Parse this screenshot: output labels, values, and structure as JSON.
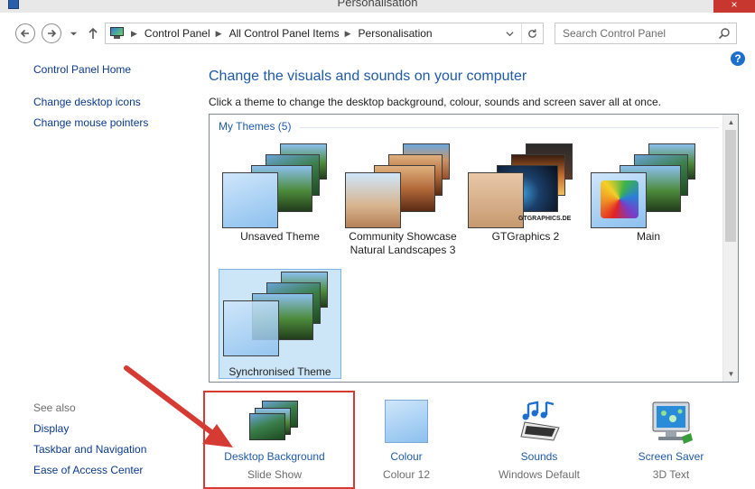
{
  "window": {
    "title": "Personalisation"
  },
  "nav": {
    "breadcrumbs": [
      "Control Panel",
      "All Control Panel Items",
      "Personalisation"
    ],
    "search_placeholder": "Search Control Panel"
  },
  "left_pane": {
    "home": "Control Panel Home",
    "links": [
      "Change desktop icons",
      "Change mouse pointers"
    ],
    "see_also_label": "See also",
    "see_also": [
      "Display",
      "Taskbar and Navigation",
      "Ease of Access Center"
    ]
  },
  "main": {
    "heading": "Change the visuals and sounds on your computer",
    "subheading": "Click a theme to change the desktop background, colour, sounds and screen saver all at once.",
    "group_label": "My Themes (5)",
    "themes": [
      {
        "name": "Unsaved Theme",
        "selected": false
      },
      {
        "name": "Community Showcase",
        "name2": "Natural Landscapes 3",
        "selected": false
      },
      {
        "name": "GTGraphics 2",
        "selected": false,
        "logo": "GTGRAPHICS.DE"
      },
      {
        "name": "Main",
        "selected": false
      },
      {
        "name": "Synchronised Theme",
        "selected": true
      }
    ]
  },
  "bottom": [
    {
      "label": "Desktop Background",
      "sub": "Slide Show",
      "icon": "desktop-background-icon"
    },
    {
      "label": "Colour",
      "sub": "Colour 12",
      "icon": "colour-swatch-icon"
    },
    {
      "label": "Sounds",
      "sub": "Windows Default",
      "icon": "sounds-icon"
    },
    {
      "label": "Screen Saver",
      "sub": "3D Text",
      "icon": "screen-saver-icon"
    }
  ],
  "annotation": {
    "color": "#d63b33"
  }
}
